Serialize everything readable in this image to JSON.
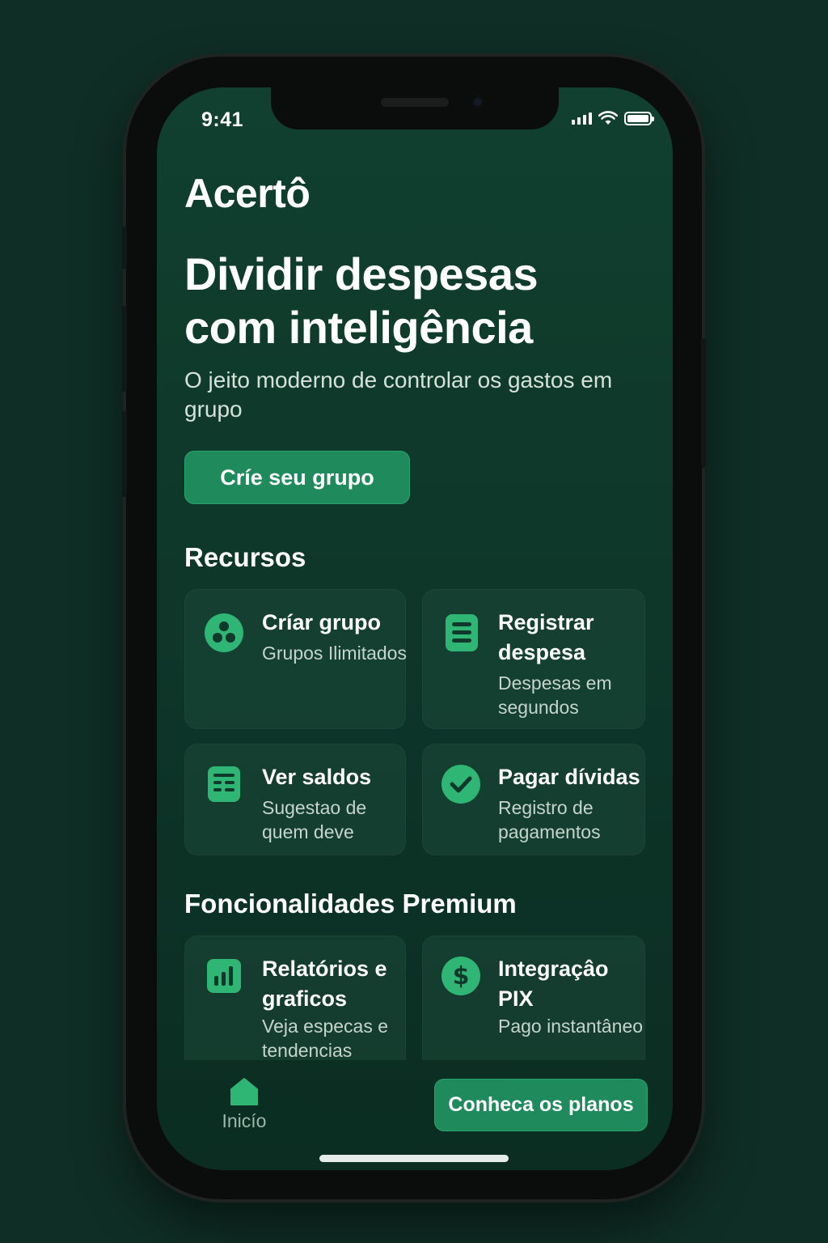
{
  "status_bar": {
    "time": "9:41"
  },
  "app": {
    "title": "Acertô"
  },
  "hero": {
    "headline": "Dividir despesas com inteligência",
    "subtitle": "O jeito moderno de controlar os gastos em grupo",
    "cta_label": "Críe seu grupo"
  },
  "resources": {
    "title": "Recursos",
    "items": [
      {
        "icon": "group-icon",
        "title": "Críar grupo",
        "desc": "Grupos Ilimitados"
      },
      {
        "icon": "list-icon",
        "title": "Registrar despesa",
        "desc": "Despesas em segundos"
      },
      {
        "icon": "balance-icon",
        "title": "Ver saldos",
        "desc": "Sugestao de quem deve"
      },
      {
        "icon": "check-icon",
        "title": "Pagar dívidas",
        "desc": "Registro de pagamentos"
      }
    ]
  },
  "premium": {
    "title": "Foncionalidades Premium",
    "items": [
      {
        "icon": "bar-chart-icon",
        "title": "Relatórios e graficos",
        "desc": "Veja especas e tendencias"
      },
      {
        "icon": "dollar-icon",
        "title": "Integraçâo PIX",
        "desc": "Pago instantâneo"
      }
    ]
  },
  "bottom": {
    "home_label": "Inicío",
    "plans_label": "Conheca os planos"
  },
  "colors": {
    "background": "#0f2e25",
    "accent": "#1f8a5b",
    "icon": "#2fb574"
  }
}
